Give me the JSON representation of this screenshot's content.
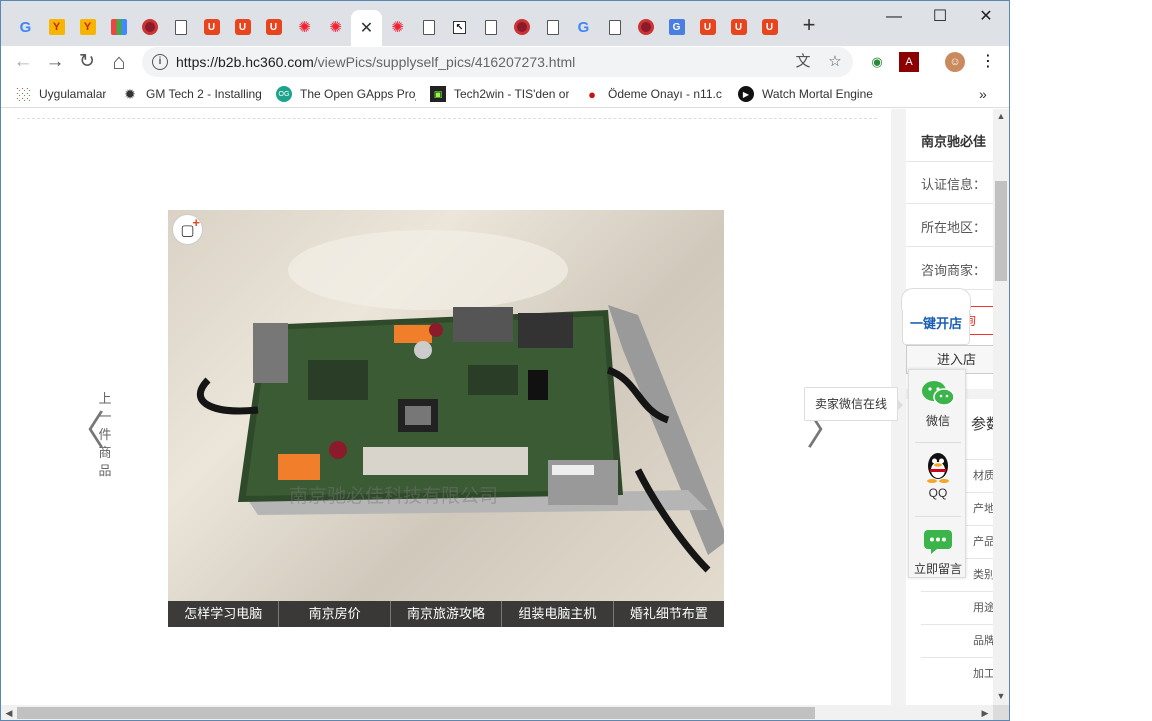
{
  "browser": {
    "url_host": "https://b2b.hc360.com",
    "url_path": "/viewPics/supplyself_pics/416207273.html",
    "new_tab_glyph": "+",
    "tabs": [
      {
        "icon": "google-icon",
        "glyph": "G"
      },
      {
        "icon": "y-app-icon",
        "glyph": "Y"
      },
      {
        "icon": "y-app-icon",
        "glyph": "Y"
      },
      {
        "icon": "color-grid-icon",
        "glyph": ""
      },
      {
        "icon": "disc-icon",
        "glyph": ""
      },
      {
        "icon": "document-icon",
        "glyph": ""
      },
      {
        "icon": "shopping-bag-icon",
        "glyph": "U"
      },
      {
        "icon": "shopping-bag-icon",
        "glyph": "U"
      },
      {
        "icon": "shopping-bag-icon",
        "glyph": "U"
      },
      {
        "icon": "swirl-icon",
        "glyph": "✺"
      },
      {
        "icon": "swirl-icon",
        "glyph": "✺"
      },
      {
        "icon": "close-icon",
        "glyph": "✕",
        "active": true
      },
      {
        "icon": "swirl-icon",
        "glyph": "✺"
      },
      {
        "icon": "document-icon",
        "glyph": ""
      },
      {
        "icon": "cursor-icon",
        "glyph": "↖"
      },
      {
        "icon": "document-icon",
        "glyph": ""
      },
      {
        "icon": "disc-icon",
        "glyph": ""
      },
      {
        "icon": "document-icon",
        "glyph": ""
      },
      {
        "icon": "google-icon",
        "glyph": "G"
      },
      {
        "icon": "document-icon",
        "glyph": ""
      },
      {
        "icon": "disc-icon",
        "glyph": ""
      },
      {
        "icon": "google-translate-icon",
        "glyph": "G"
      },
      {
        "icon": "shopping-bag-icon",
        "glyph": "U"
      },
      {
        "icon": "shopping-bag-icon",
        "glyph": "U"
      },
      {
        "icon": "shopping-bag-icon",
        "glyph": "U"
      }
    ],
    "window_controls": {
      "minimize": "—",
      "maximize": "☐",
      "close": "✕"
    },
    "nav": {
      "back": "←",
      "forward": "→",
      "reload": "↻",
      "home": "⌂"
    }
  },
  "bookmarks": [
    {
      "label": "Uygulamalar",
      "icon": "apps-grid-icon"
    },
    {
      "label": "GM Tech 2 - Installing",
      "icon": "gear-icon"
    },
    {
      "label": "The Open GApps Proj",
      "icon": "opengapps-icon"
    },
    {
      "label": "Tech2win - TIS'den or",
      "icon": "tech2win-icon"
    },
    {
      "label": "Ödeme Onayı - n11.c",
      "icon": "ladybug-icon"
    },
    {
      "label": "Watch Mortal Engine",
      "icon": "play-icon"
    }
  ],
  "bookmarks_overflow": "»",
  "gallery": {
    "prev_label": "上一件商品",
    "prev_arrow": "〈",
    "next_arrow": "〉",
    "watermark": "南京驰必佳科技有限公司",
    "fav_glyph": "▢",
    "fav_plus": "+",
    "captions": [
      "怎样学习电脑",
      "南京房价",
      "南京旅游攻略",
      "组装电脑主机",
      "婚礼细节布置"
    ]
  },
  "seller": {
    "name": "南京驰必佳",
    "rows": [
      "认证信息：",
      "所在地区：",
      "咨询商家："
    ],
    "inquire_button": "立即询",
    "shop_button": "进入店"
  },
  "params": {
    "title": "参数",
    "rows": [
      "材质",
      "产地",
      "产品认",
      "类别",
      "用途",
      "品牌",
      "加工定"
    ]
  },
  "open_shop": "一键开店",
  "float_panel": {
    "tooltip": "卖家微信在线",
    "items": [
      {
        "label": "微信",
        "icon": "wechat-icon"
      },
      {
        "label": "QQ",
        "icon": "qq-penguin-icon"
      },
      {
        "label": "立即留言",
        "icon": "message-bubble-icon"
      }
    ]
  },
  "colors": {
    "accent_red": "#e8451e",
    "link_blue": "#1a5fb4",
    "wechat_green": "#3bb54a"
  }
}
